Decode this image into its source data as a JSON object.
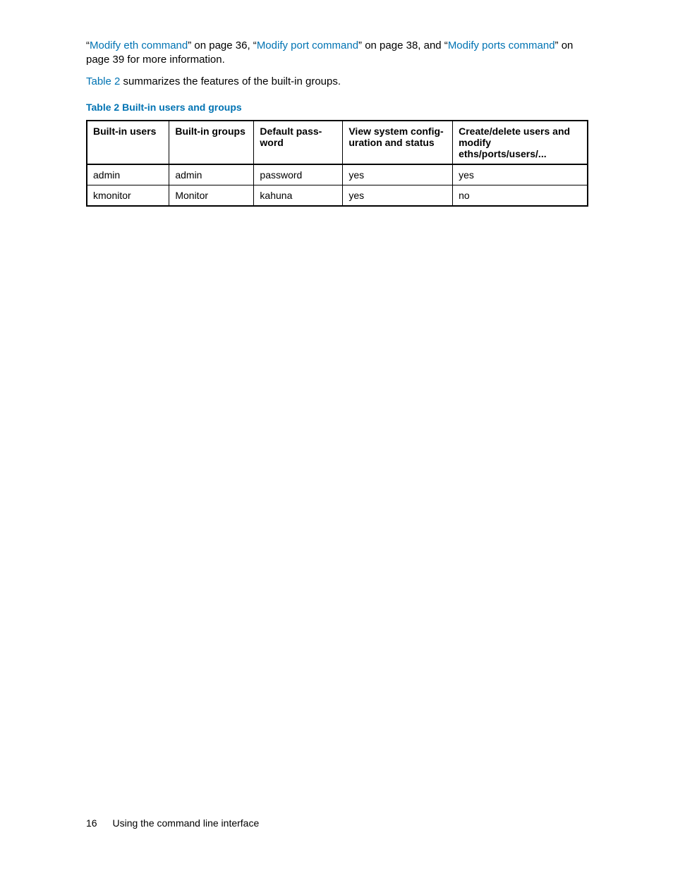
{
  "intro": {
    "quote_open_1": "“",
    "link1": "Modify eth command",
    "after1": "” on page 36, “",
    "link2": "Modify port command",
    "after2": "” on page 38, and “",
    "link3": "Modify ports command",
    "after3": "” on page 39 for more information."
  },
  "summary_line": {
    "link": "Table 2",
    "rest": " summarizes the features of the built-in groups."
  },
  "table": {
    "caption": "Table 2 Built-in users and groups",
    "headers": {
      "c1": "Built-in users",
      "c2": "Built-in groups",
      "c3": "Default pass­word",
      "c4": "View system config­uration and status",
      "c5": "Create/delete users and modify eths/ports/users/..."
    },
    "rows": [
      {
        "c1": "admin",
        "c2": "admin",
        "c3": "password",
        "c4": "yes",
        "c5": "yes"
      },
      {
        "c1": "kmonitor",
        "c2": "Monitor",
        "c3": "kahuna",
        "c4": "yes",
        "c5": "no"
      }
    ]
  },
  "footer": {
    "page_number": "16",
    "section": "Using the command line interface"
  }
}
